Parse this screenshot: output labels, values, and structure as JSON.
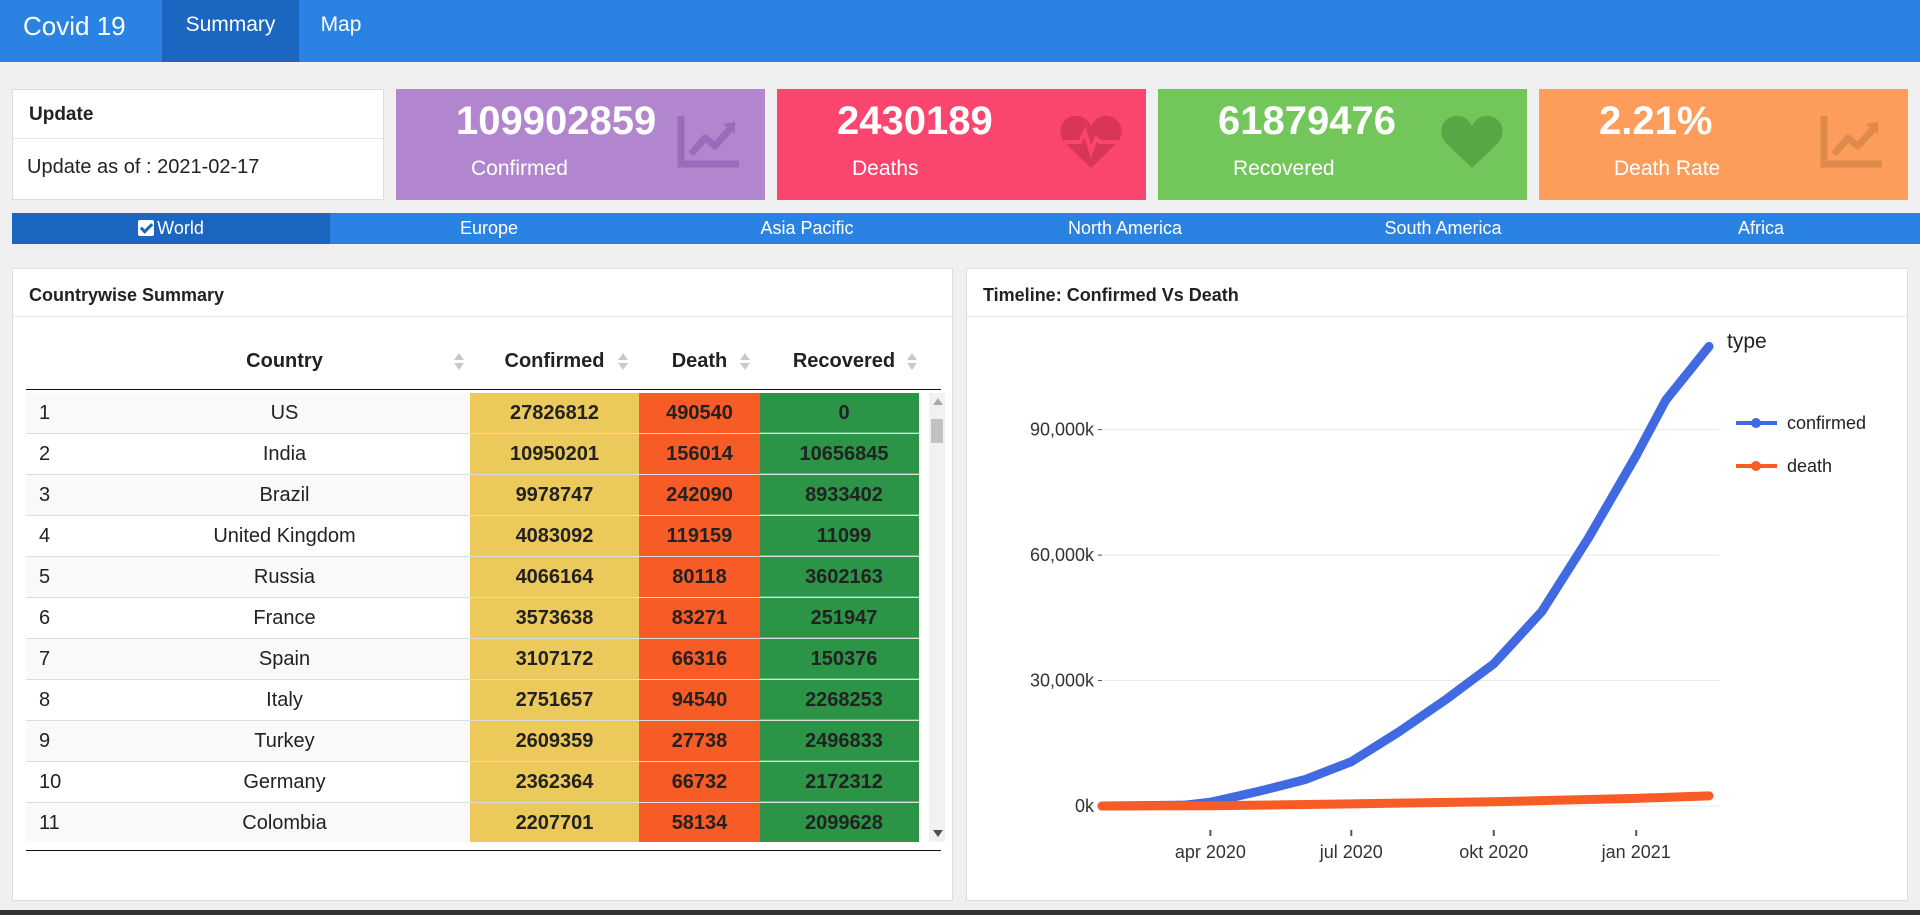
{
  "app": {
    "title": "Covid 19"
  },
  "nav": {
    "tabs": [
      {
        "label": "Summary"
      },
      {
        "label": "Map"
      }
    ]
  },
  "update": {
    "title": "Update",
    "text": "Update as of : 2021-02-17"
  },
  "value_boxes": [
    {
      "value": "109902859",
      "label": "Confirmed",
      "icon": "chart-line-icon",
      "color": "#b286cf"
    },
    {
      "value": "2430189",
      "label": "Deaths",
      "icon": "heartbeat-icon",
      "color": "#fa466e"
    },
    {
      "value": "61879476",
      "label": "Recovered",
      "icon": "heart-icon",
      "color": "#73c65a"
    },
    {
      "value": "2.21%",
      "label": "Death Rate",
      "icon": "chart-line-icon",
      "color": "#fc9d5b"
    }
  ],
  "regions": [
    {
      "label": "World",
      "selected": true
    },
    {
      "label": "Europe"
    },
    {
      "label": "Asia Pacific"
    },
    {
      "label": "North America"
    },
    {
      "label": "South America"
    },
    {
      "label": "Africa"
    }
  ],
  "table": {
    "title": "Countrywise Summary",
    "headers": [
      "Country",
      "Confirmed",
      "Death",
      "Recovered"
    ],
    "rows": [
      [
        "1",
        "US",
        "27826812",
        "490540",
        "0"
      ],
      [
        "2",
        "India",
        "10950201",
        "156014",
        "10656845"
      ],
      [
        "3",
        "Brazil",
        "9978747",
        "242090",
        "8933402"
      ],
      [
        "4",
        "United Kingdom",
        "4083092",
        "119159",
        "11099"
      ],
      [
        "5",
        "Russia",
        "4066164",
        "80118",
        "3602163"
      ],
      [
        "6",
        "France",
        "3573638",
        "83271",
        "251947"
      ],
      [
        "7",
        "Spain",
        "3107172",
        "66316",
        "150376"
      ],
      [
        "8",
        "Italy",
        "2751657",
        "94540",
        "2268253"
      ],
      [
        "9",
        "Turkey",
        "2609359",
        "27738",
        "2496833"
      ],
      [
        "10",
        "Germany",
        "2362364",
        "66732",
        "2172312"
      ],
      [
        "11",
        "Colombia",
        "2207701",
        "58134",
        "2099628"
      ]
    ],
    "colors": {
      "confirmed": "#ecc95b",
      "death": "#f75b26",
      "recovered": "#2b9446"
    }
  },
  "chart_data": {
    "type": "line",
    "title": "Timeline: Confirmed Vs Death",
    "legend_title": "type",
    "legend_position": "top-right",
    "grid": true,
    "x_tick_labels": [
      "apr 2020",
      "jul 2020",
      "okt 2020",
      "jan 2021"
    ],
    "y_tick_labels": [
      "0k",
      "30,000k",
      "60,000k",
      "90,000k"
    ],
    "ylim": [
      0,
      110000
    ],
    "series": [
      {
        "name": "confirmed",
        "color": "#4169e1",
        "x": [
          "2020-01-22",
          "2020-03-15",
          "2020-04-01",
          "2020-05-01",
          "2020-06-01",
          "2020-07-01",
          "2020-08-01",
          "2020-09-01",
          "2020-10-01",
          "2020-11-01",
          "2020-12-01",
          "2021-01-01",
          "2021-01-20",
          "2021-02-17"
        ],
        "values": [
          0,
          200,
          900,
          3400,
          6300,
          10600,
          17800,
          25700,
          34000,
          46500,
          64000,
          83800,
          97000,
          109900
        ]
      },
      {
        "name": "death",
        "color": "#f75b26",
        "x": [
          "2020-01-22",
          "2020-04-01",
          "2020-07-01",
          "2020-10-01",
          "2021-01-01",
          "2021-02-17"
        ],
        "values": [
          0,
          50,
          520,
          1030,
          1830,
          2430
        ]
      }
    ]
  }
}
